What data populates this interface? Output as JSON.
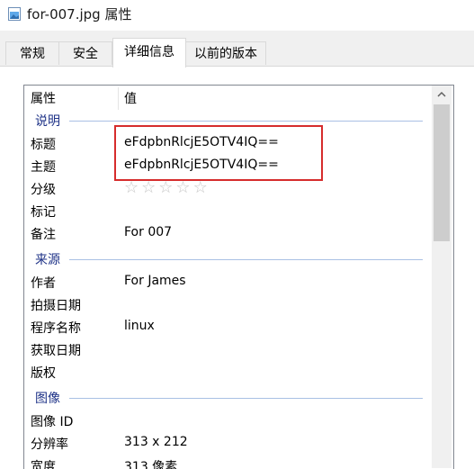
{
  "window": {
    "title": "for-007.jpg 属性"
  },
  "tabs": [
    {
      "label": "常规",
      "active": false
    },
    {
      "label": "安全",
      "active": false
    },
    {
      "label": "详细信息",
      "active": true
    },
    {
      "label": "以前的版本",
      "active": false
    }
  ],
  "columns": {
    "property": "属性",
    "value": "值"
  },
  "groups": {
    "description": "说明",
    "origin": "来源",
    "image": "图像"
  },
  "rows": {
    "title": {
      "k": "标题",
      "v": "eFdpbnRlcjE5OTV4IQ=="
    },
    "subject": {
      "k": "主题",
      "v": "eFdpbnRlcjE5OTV4IQ=="
    },
    "rating": {
      "k": "分级",
      "stars": 0,
      "max": 5
    },
    "tags": {
      "k": "标记",
      "v": ""
    },
    "comments": {
      "k": "备注",
      "v": "For 007"
    },
    "author": {
      "k": "作者",
      "v": "For James"
    },
    "date_taken": {
      "k": "拍摄日期",
      "v": ""
    },
    "program": {
      "k": "程序名称",
      "v": "linux"
    },
    "date_acquired": {
      "k": "获取日期",
      "v": ""
    },
    "copyright": {
      "k": "版权",
      "v": ""
    },
    "image_id": {
      "k": "图像 ID",
      "v": ""
    },
    "resolution": {
      "k": "分辨率",
      "v": "313 x 212"
    },
    "width": {
      "k": "宽度",
      "v": "313 像素"
    }
  },
  "icons": {
    "file": "image-file-icon",
    "scroll_up": "chevron-up-icon",
    "star": "star-icon"
  },
  "colors": {
    "group_text": "#1e3287",
    "highlight_box": "#d62c2c"
  }
}
